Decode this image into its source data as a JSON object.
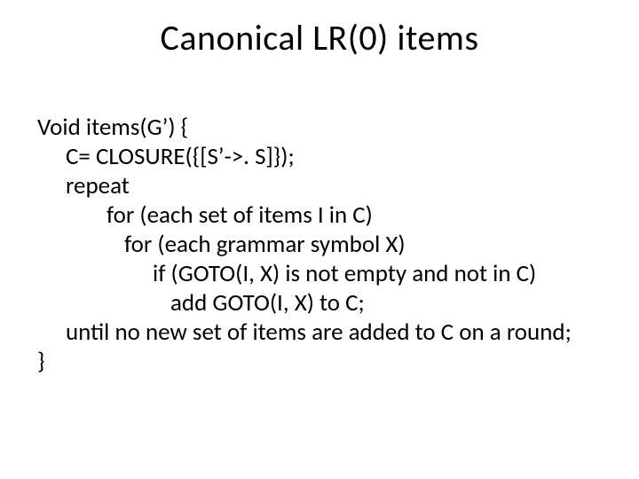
{
  "title": "Canonical LR(0) items",
  "lines": {
    "l0": "Void items(G’) {",
    "l1": "C= CLOSURE({[S’->. S]});",
    "l2": "repeat",
    "l3": "for (each set of items I in C)",
    "l4": "for (each grammar symbol X)",
    "l5": "if (GOTO(I, X) is not empty and not in C)",
    "l6": "add GOTO(I, X) to C;",
    "l7": "until no new set of items are added to C on a round;",
    "l8": "}"
  }
}
